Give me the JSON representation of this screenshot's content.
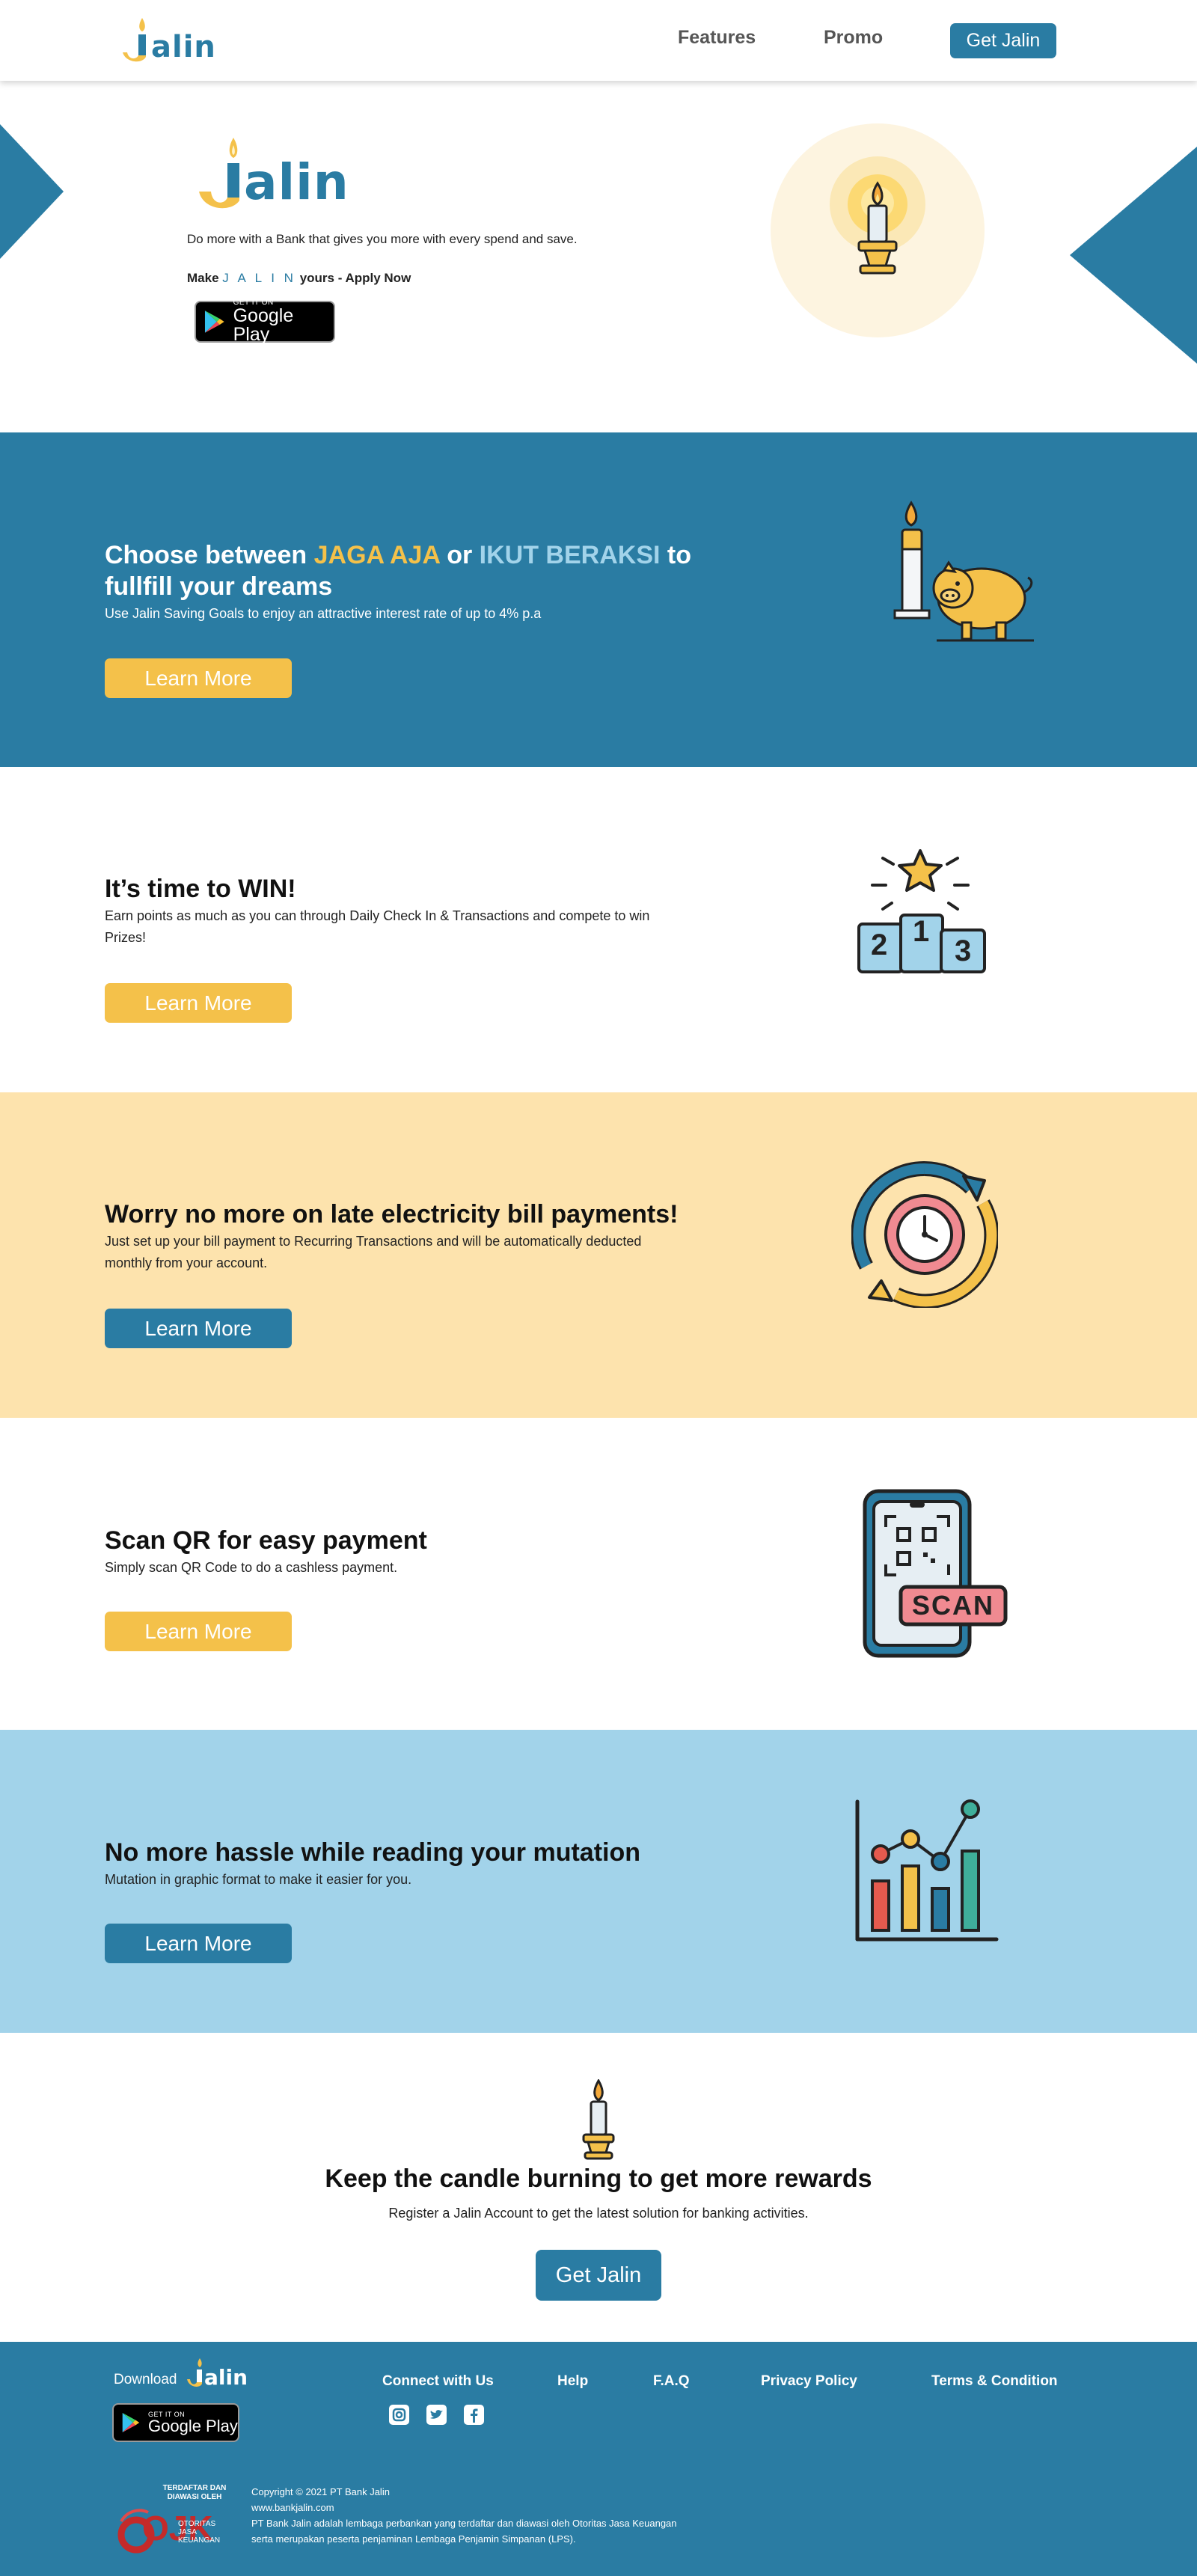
{
  "brand": {
    "name": "Jalin",
    "name_rest": "alin",
    "name_first": "J"
  },
  "nav": {
    "links": [
      "Features",
      "Promo"
    ],
    "cta": "Get Jalin"
  },
  "hero": {
    "tagline": "Do more with a Bank that gives you more with every spend and save.",
    "apply_prefix": "Make",
    "apply_brand": "J A L I N",
    "apply_suffix": "yours - Apply Now",
    "gplay_small": "GET IT ON",
    "gplay_big": "Google Play"
  },
  "sections": [
    {
      "title_parts": [
        "Choose between ",
        "JAGA AJA",
        " or ",
        "IKUT BERAKSI",
        " to"
      ],
      "title_line2": "fullfill your dreams",
      "desc": "Use Jalin Saving Goals to enjoy an attractive interest rate of up to 4% p.a",
      "button": "Learn More"
    },
    {
      "title": "It’s time to WIN!",
      "desc": "Earn points as much as you can through Daily Check In & Transactions and compete to win Prizes!",
      "button": "Learn More",
      "podium": [
        "2",
        "1",
        "3"
      ]
    },
    {
      "title": "Worry no more on late electricity bill payments!",
      "desc": "Just set up your bill payment to Recurring Transactions and will be automatically deducted monthly from your account.",
      "button": "Learn More"
    },
    {
      "title": "Scan QR for easy payment",
      "desc": "Simply scan QR Code to do a cashless payment.",
      "button": "Learn More",
      "badge": "SCAN"
    },
    {
      "title": "No more hassle while reading your mutation",
      "desc": "Mutation in graphic format to make it easier for you.",
      "button": "Learn More"
    }
  ],
  "cta": {
    "title": "Keep the candle burning to get more rewards",
    "desc": "Register a Jalin Account to get the latest solution for banking activities.",
    "button": "Get Jalin"
  },
  "footer": {
    "download": "Download",
    "links": [
      "Connect with Us",
      "Help",
      "F.A.Q",
      "Privacy Policy",
      "Terms & Condition"
    ],
    "ojk_top": "TERDAFTAR DAN DIAWASI OLEH",
    "ojk_name": "OJK",
    "ojk_sub": "OTORITAS JASA KEUANGAN",
    "copyright": "Copyright © 2021 PT Bank Jalin",
    "website": "www.bankjalin.com",
    "legal1": "PT Bank Jalin adalah lembaga perbankan yang terdaftar dan diawasi oleh Otoritas Jasa Keuangan",
    "legal2": "serta merupakan peserta penjaminan Lembaga Penjamin Simpanan (LPS)."
  },
  "colors": {
    "primary": "#2a7ca3",
    "accent_yellow": "#f4c14a",
    "light_blue": "#a2d3ea",
    "cream": "#fde3ad"
  }
}
